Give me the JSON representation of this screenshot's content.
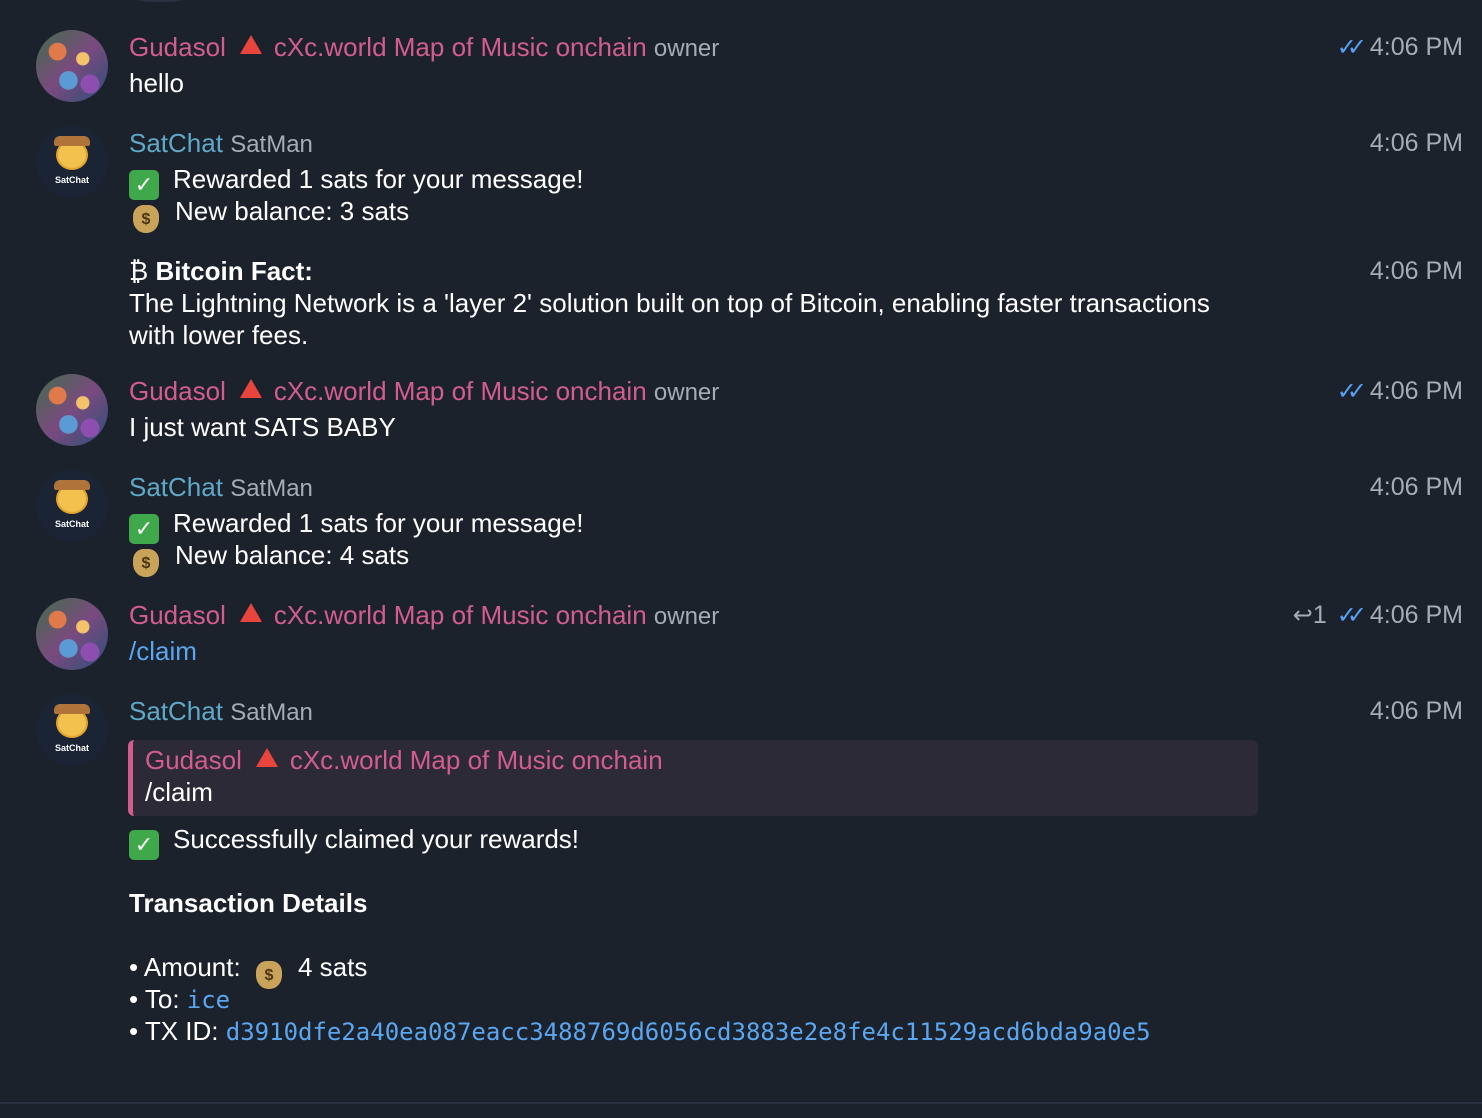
{
  "messages": [
    {
      "sender": "Gudasol",
      "chat": "cXc.world Map of Music onchain",
      "role": "owner",
      "text": "hello",
      "time": "4:06 PM"
    },
    {
      "sender": "SatChat",
      "role": "SatMan",
      "avatar_label": "SatChat",
      "line1": "Rewarded 1 sats for your message!",
      "line2": "New balance: 3 sats",
      "time": "4:06 PM"
    },
    {
      "fact_symbol": "₿",
      "fact_title": "Bitcoin Fact:",
      "fact_line1": "The Lightning Network is a 'layer 2' solution built on top of Bitcoin, enabling faster transactions",
      "fact_line2": "with lower fees.",
      "time": "4:06 PM"
    },
    {
      "sender": "Gudasol",
      "chat": "cXc.world Map of Music onchain",
      "role": "owner",
      "text": "I just want SATS BABY",
      "time": "4:06 PM"
    },
    {
      "sender": "SatChat",
      "role": "SatMan",
      "avatar_label": "SatChat",
      "line1": "Rewarded 1 sats for your message!",
      "line2": "New balance: 4 sats",
      "time": "4:06 PM"
    },
    {
      "sender": "Gudasol",
      "chat": "cXc.world Map of Music onchain",
      "role": "owner",
      "text": "/claim",
      "reply_count": "1",
      "time": "4:06 PM"
    },
    {
      "sender": "SatChat",
      "role": "SatMan",
      "avatar_label": "SatChat",
      "quote_sender": "Gudasol",
      "quote_chat": "cXc.world Map of Music onchain",
      "quote_text": "/claim",
      "success": "Successfully claimed your rewards!",
      "details_title": "Transaction Details",
      "amount_label": "• Amount:",
      "amount_value": "4 sats",
      "to_label": "• To:",
      "to_value": "ice",
      "tx_label": "• TX ID:",
      "tx_value": "d3910dfe2a40ea087eacc3488769d6056cd3883e2e8fe4c11529acd6bda9a0e5",
      "time": "4:06 PM"
    }
  ],
  "icons": {
    "check": "double-check-icon",
    "reply": "reply-arrow-icon",
    "ok": "check-mark-emoji",
    "bag": "money-bag-emoji",
    "badge": "red-triangle-icon"
  },
  "colors": {
    "background": "#1c222c",
    "gudasol_name": "#d35d8c",
    "satchat_name": "#5fa8c7",
    "link": "#5aa6f0",
    "muted": "#a4acb6"
  }
}
